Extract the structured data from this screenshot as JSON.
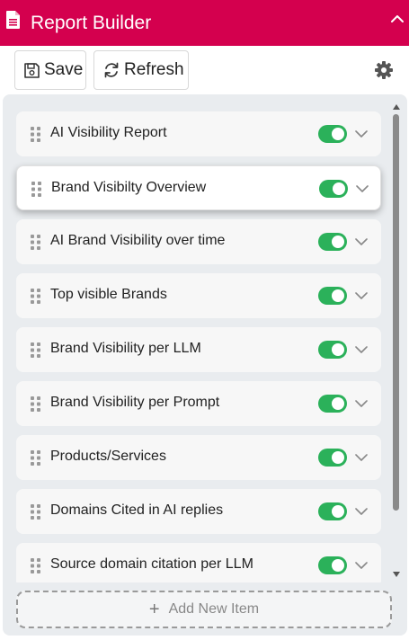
{
  "header": {
    "title": "Report Builder"
  },
  "toolbar": {
    "save_label": "Save",
    "refresh_label": "Refresh"
  },
  "items": [
    {
      "label": "AI Visibility Report",
      "enabled": true
    },
    {
      "label": "Brand Visibilty Overview",
      "enabled": true
    },
    {
      "label": "AI Brand Visibility over time",
      "enabled": true
    },
    {
      "label": "Top visible Brands",
      "enabled": true
    },
    {
      "label": "Brand Visibility per LLM",
      "enabled": true
    },
    {
      "label": "Brand Visibility per Prompt",
      "enabled": true
    },
    {
      "label": "Products/Services",
      "enabled": true
    },
    {
      "label": "Domains Cited in AI replies",
      "enabled": true
    },
    {
      "label": "Source domain citation per LLM",
      "enabled": true
    }
  ],
  "add_item": {
    "label": "Add New Item",
    "icon": "+"
  },
  "colors": {
    "brand": "#d4004e",
    "toggle_on": "#2bb15a"
  }
}
